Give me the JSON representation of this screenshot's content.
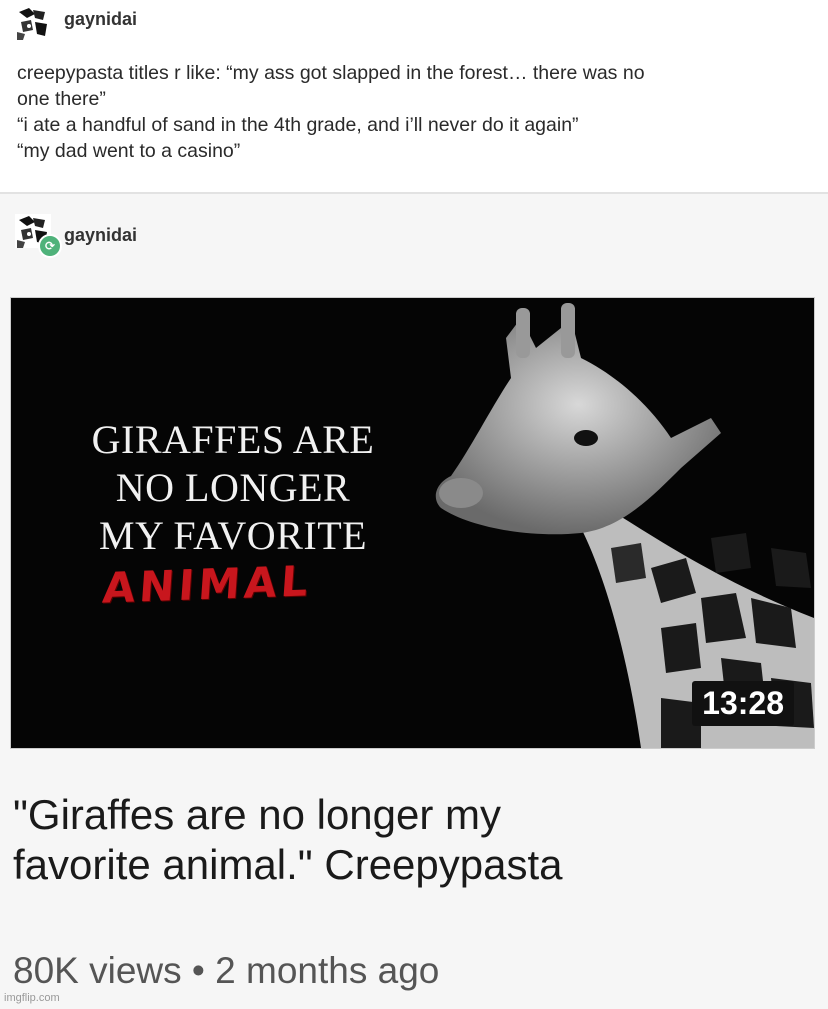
{
  "post1": {
    "username": "gaynidai",
    "lines": [
      "creepypasta titles r like: “my ass got slapped in the forest… there was no",
      "one there”",
      "“i ate a handful of sand in the 4th grade, and i’ll never do it again”",
      "“my dad went to a casino”"
    ]
  },
  "post2": {
    "username": "gaynidai",
    "reblog_icon": "reblog-icon",
    "thumbnail": {
      "lines": [
        "GIRAFFES ARE",
        "NO LONGER",
        "MY FAVORITE"
      ],
      "red_word": "ANIMAL",
      "duration": "13:28"
    },
    "video_title_lines": [
      "\"Giraffes are no longer my",
      "favorite animal.\" Creepypasta"
    ],
    "meta": "80K views • 2 months ago"
  },
  "watermark": "imgflip.com"
}
